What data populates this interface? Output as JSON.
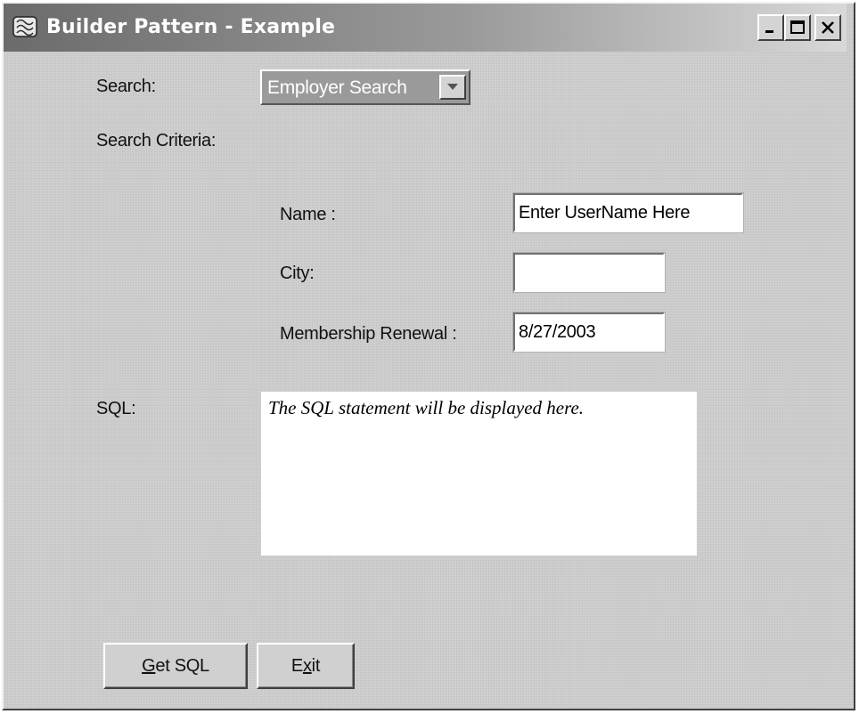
{
  "window": {
    "title": "Builder Pattern - Example",
    "icon": "app-logo-icon",
    "controls": [
      "minimize-icon",
      "maximize-icon",
      "close-icon"
    ]
  },
  "search": {
    "label": "Search:",
    "selected": "Employer Search"
  },
  "criteria": {
    "label": "Search Criteria:",
    "name_label": "Name :",
    "name_value": "Enter UserName Here",
    "city_label": "City:",
    "city_value": "",
    "renewal_label": "Membership Renewal :",
    "renewal_value": "8/27/2003"
  },
  "sql": {
    "label": "SQL:",
    "text": "The SQL statement will be displayed here."
  },
  "buttons": {
    "get_sql": {
      "mnemonic": "G",
      "rest": "et SQL"
    },
    "exit": {
      "pre": "E",
      "mnemonic": "x",
      "post": "it"
    }
  }
}
